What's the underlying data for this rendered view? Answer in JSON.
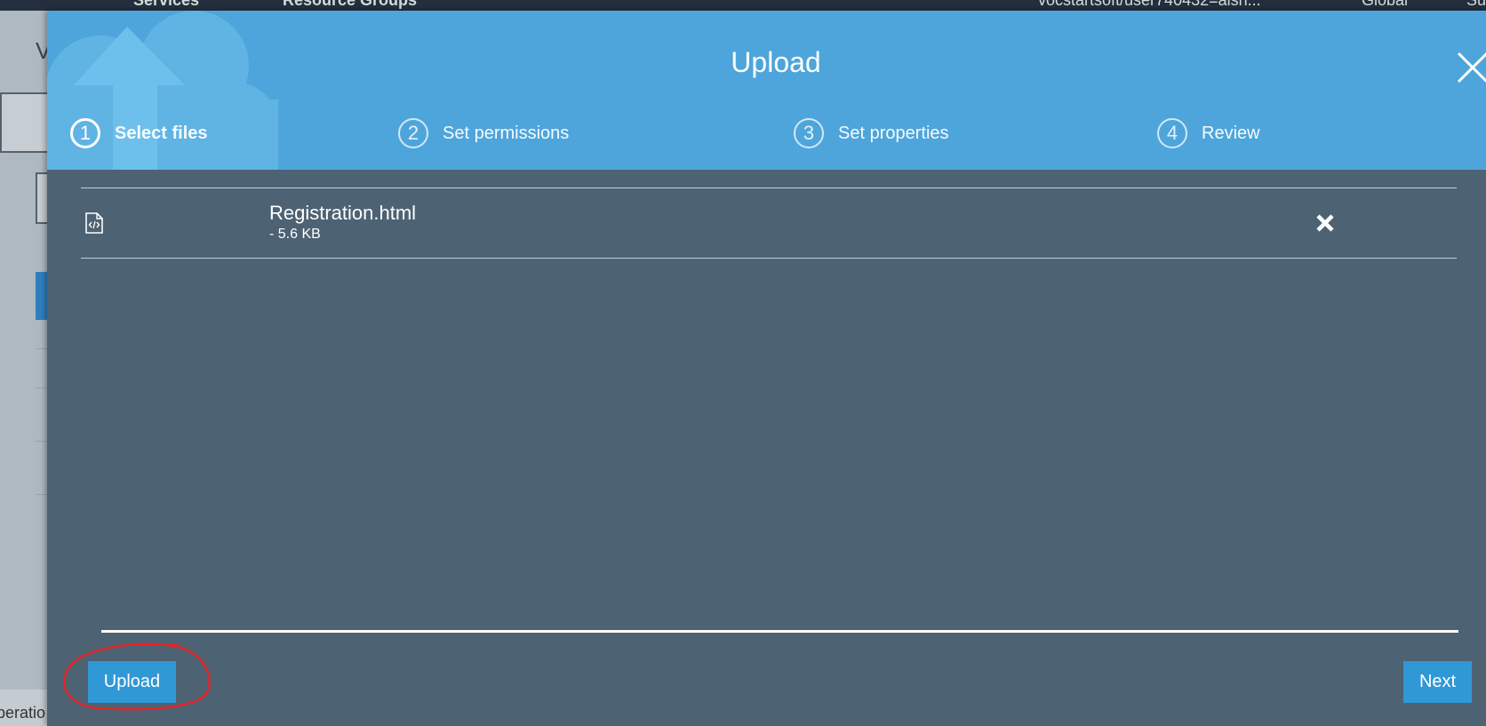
{
  "console": {
    "services_label": "Services",
    "resource_groups_label": "Resource Groups",
    "account_label": "vocstartsoft/user740432=aish...",
    "region_label": "Global",
    "support_label": "Su",
    "page_title_partial": "V",
    "footer_partial": "peratio"
  },
  "modal": {
    "title": "Upload",
    "steps": [
      {
        "number": "1",
        "label": "Select files",
        "active": true
      },
      {
        "number": "2",
        "label": "Set permissions",
        "active": false
      },
      {
        "number": "3",
        "label": "Set properties",
        "active": false
      },
      {
        "number": "4",
        "label": "Review",
        "active": false
      }
    ],
    "files": [
      {
        "name": "Registration.html",
        "size": "- 5.6 KB",
        "icon": "html-file-icon"
      }
    ],
    "upload_button_label": "Upload",
    "next_button_label": "Next"
  },
  "colors": {
    "header_blue": "#4ea5db",
    "modal_body": "#4d6272",
    "button_blue": "#3198d6",
    "annotation_red": "#e0242a"
  }
}
